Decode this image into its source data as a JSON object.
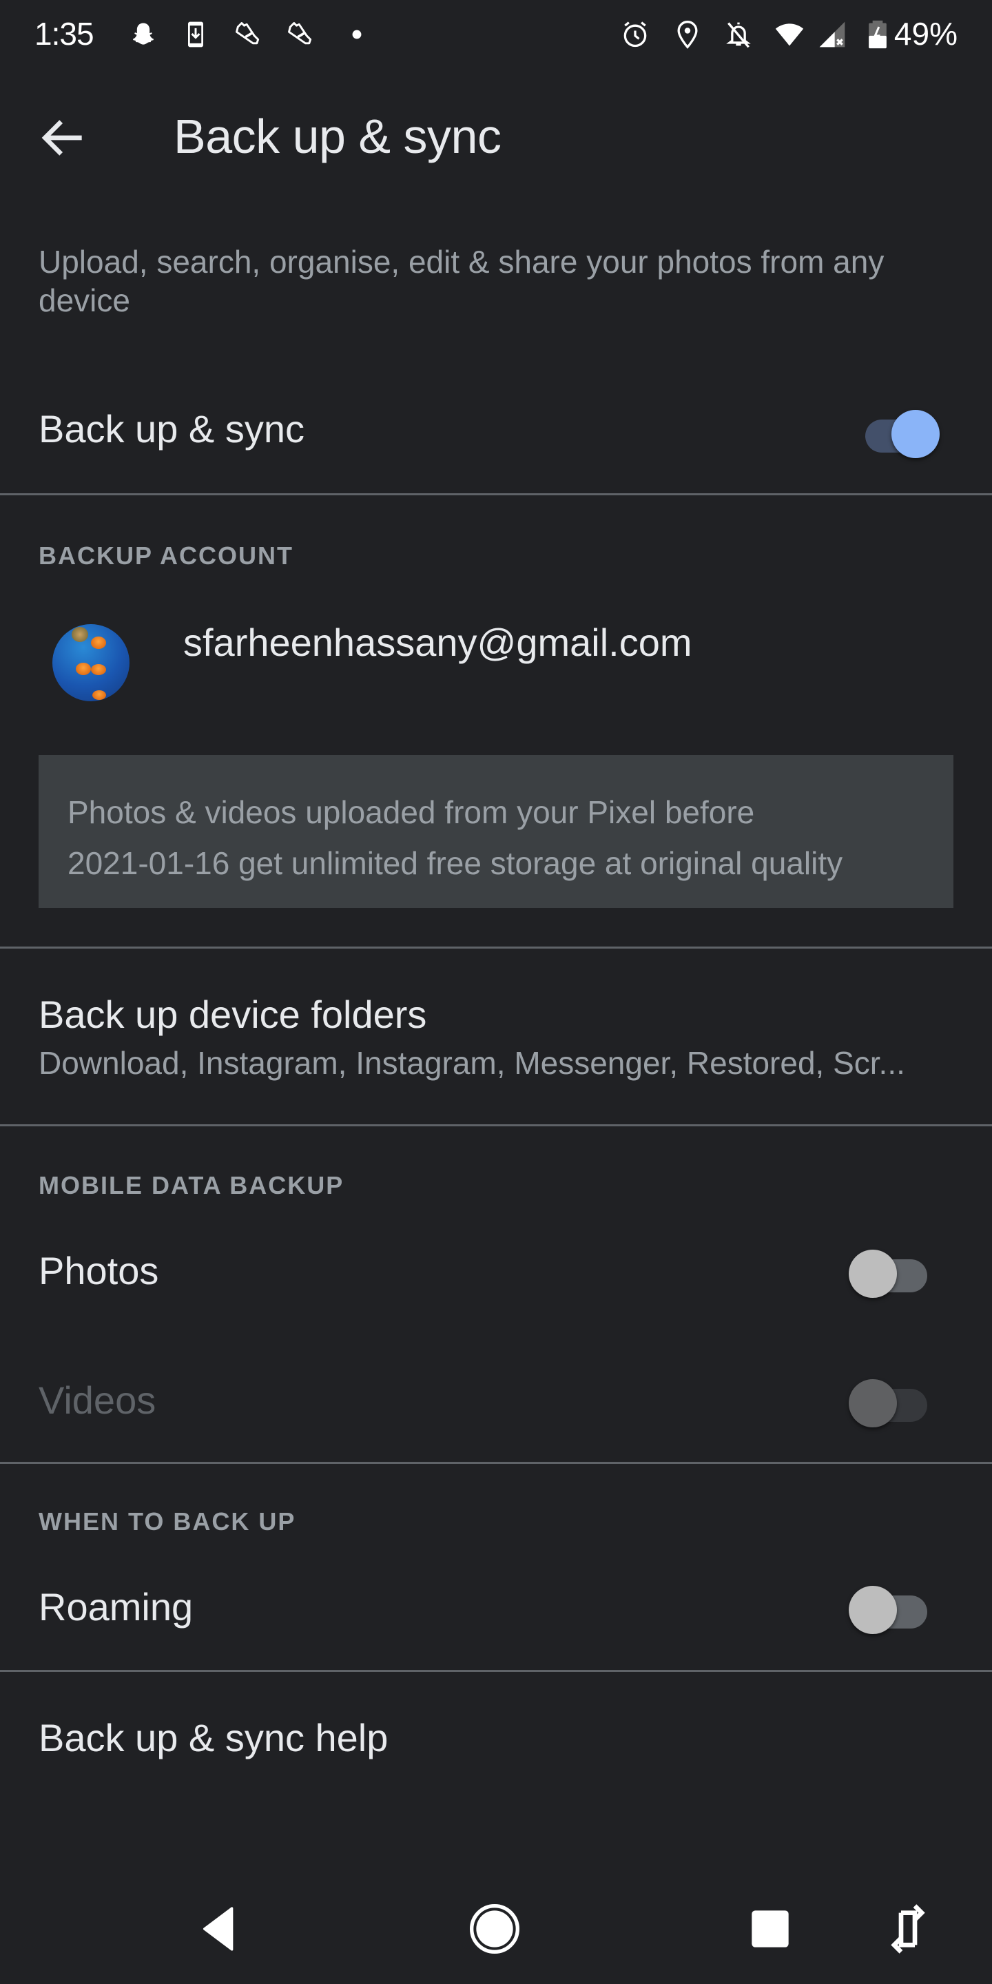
{
  "status_bar": {
    "time": "1:35",
    "left_icons": [
      "snapchat-icon",
      "download-phone-icon",
      "sneaker-icon",
      "sneaker-icon",
      "dot-icon"
    ],
    "right_icons": [
      "alarm-icon",
      "location-icon",
      "notifications-off-icon",
      "wifi-icon",
      "cell-signal-no-data-icon",
      "battery-charging-icon"
    ],
    "battery": "49%"
  },
  "app_bar": {
    "back_icon": "arrow-back-icon",
    "title": "Back up & sync"
  },
  "description": "Upload, search, organise, edit & share your photos from any device",
  "backup_sync": {
    "label": "Back up & sync",
    "enabled": true
  },
  "backup_account": {
    "header": "BACKUP ACCOUNT",
    "email": "sfarheenhassany@gmail.com",
    "avatar": "jellyfish-photo-avatar",
    "info_line1": "Photos & videos uploaded from your Pixel before",
    "info_line2": "2021-01-16 get unlimited free storage at original quality"
  },
  "device_folders": {
    "label": "Back up device folders",
    "summary": "Download, Instagram, Instagram, Messenger, Restored, Scr..."
  },
  "mobile_data_backup": {
    "header": "MOBILE DATA BACKUP",
    "items": [
      {
        "label": "Photos",
        "enabled": false,
        "disabled": false
      },
      {
        "label": "Videos",
        "enabled": false,
        "disabled": true
      }
    ]
  },
  "when_to_back_up": {
    "header": "WHEN TO BACK UP",
    "items": [
      {
        "label": "Roaming",
        "enabled": false
      }
    ]
  },
  "help": {
    "label": "Back up & sync help"
  },
  "nav_bar": {
    "buttons": [
      "back-triangle-icon",
      "home-circle-icon",
      "recents-square-icon",
      "rotate-icon"
    ]
  },
  "colors": {
    "background": "#202124",
    "accent": "#8ab4f8",
    "info_box": "#3c4043",
    "secondary_text": "#9aa0a6"
  }
}
